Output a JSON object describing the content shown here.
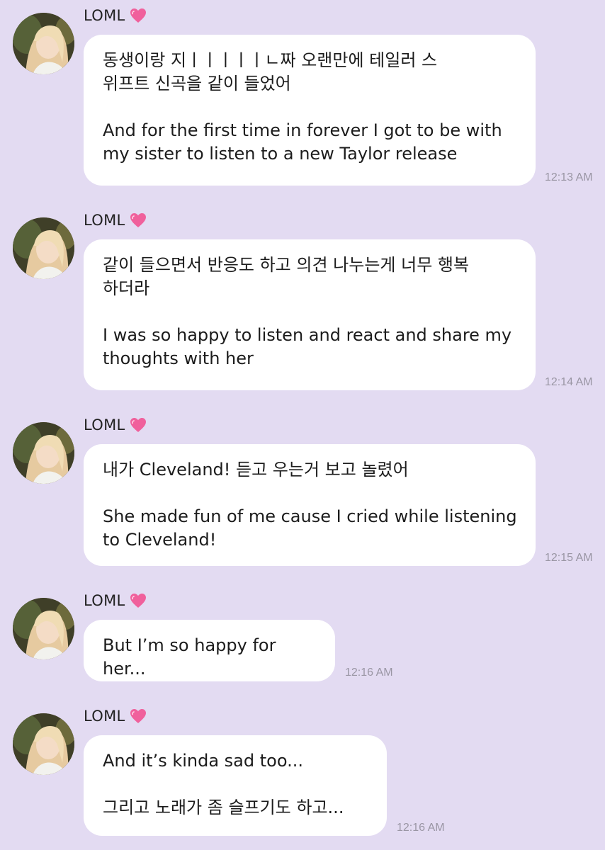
{
  "sender": "LOML",
  "messages": [
    {
      "text": "동생이랑 지ㅣㅣㅣㅣㅣㄴ짜 오랜만에 테일러 스\n위프트 신곡을 같이 들었어\n\nAnd for the first time in forever I got to be with\nmy sister to listen to a new Taylor release",
      "time": "12:13 AM"
    },
    {
      "text": "같이 들으면서 반응도 하고 의견 나누는게 너무 행복\n하더라\n\nI was so happy to listen and react and share my\nthoughts with her",
      "time": "12:14 AM"
    },
    {
      "text": "내가 Cleveland! 듣고 우는거 보고 놀렸어\n\nShe made fun of me cause I cried while listening\nto Cleveland!",
      "time": "12:15 AM"
    },
    {
      "text": "But I’m so happy for her...",
      "time": "12:16 AM"
    },
    {
      "text": "And it’s kinda sad too...\n\n그리고 노래가 좀 슬프기도 하고...",
      "time": "12:16 AM"
    }
  ],
  "icons": {
    "avatar": "profile-photo-icon",
    "heart": "pink-heart-icon"
  },
  "colors": {
    "background": "#e3dbf2",
    "bubble": "#ffffff",
    "heart": "#f0609c"
  }
}
